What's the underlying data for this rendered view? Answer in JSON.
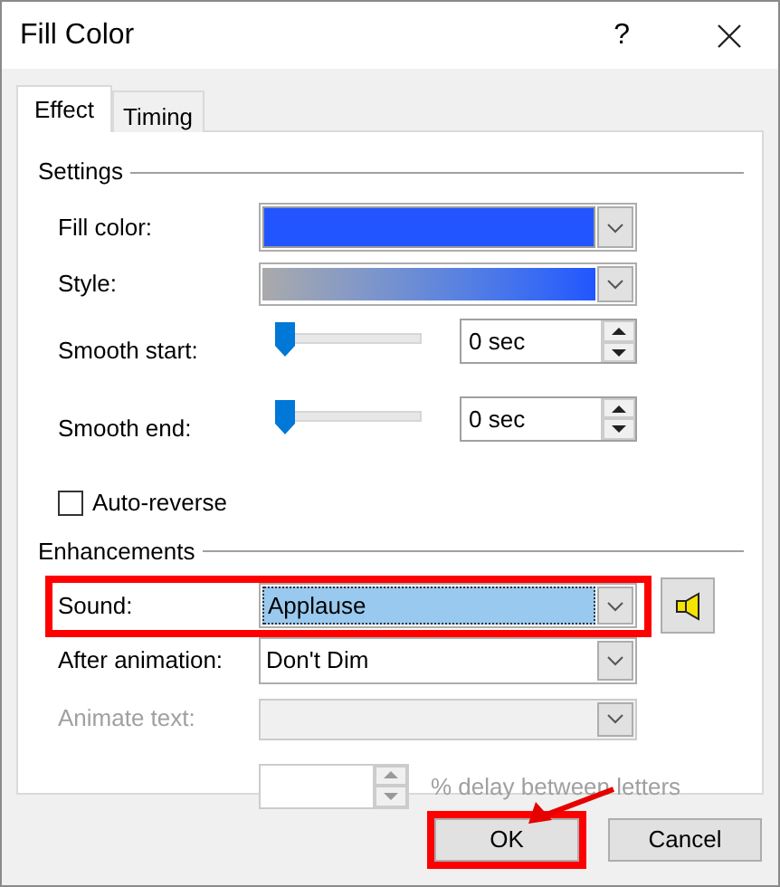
{
  "window": {
    "title": "Fill Color",
    "help": "?"
  },
  "tabs": [
    {
      "label": "Effect",
      "selected": true
    },
    {
      "label": "Timing",
      "selected": false
    }
  ],
  "settings": {
    "title": "Settings",
    "rows": [
      {
        "kind": "color",
        "label": "Fill color:",
        "color": "#2255ff"
      },
      {
        "kind": "gradient",
        "label": "Style:"
      },
      {
        "kind": "slider",
        "label": "Smooth start:",
        "level": 0,
        "value": "0 sec"
      },
      {
        "kind": "slider",
        "label": "Smooth end:",
        "level": 0,
        "value": "0 sec"
      },
      {
        "kind": "checkbox",
        "label": "Auto-reverse",
        "checked": false
      }
    ]
  },
  "enhancements": {
    "title": "Enhancements",
    "rows": [
      {
        "kind": "dropdown",
        "label": "Sound:",
        "value": "Applause",
        "selected": true,
        "disabled": false,
        "highlighted": true,
        "preview_button": true
      },
      {
        "kind": "dropdown",
        "label": "After animation:",
        "value": "Don't Dim",
        "selected": false,
        "disabled": false,
        "highlighted": false
      },
      {
        "kind": "dropdown",
        "label": "Animate text:",
        "selected": false,
        "disabled": true,
        "highlighted": false
      },
      {
        "kind": "spin",
        "suffix": "% delay between letters",
        "disabled": true
      }
    ]
  },
  "buttons": [
    {
      "label": "OK",
      "highlighted": true
    },
    {
      "label": "Cancel",
      "highlighted": false
    }
  ],
  "annotation_arrow": true
}
